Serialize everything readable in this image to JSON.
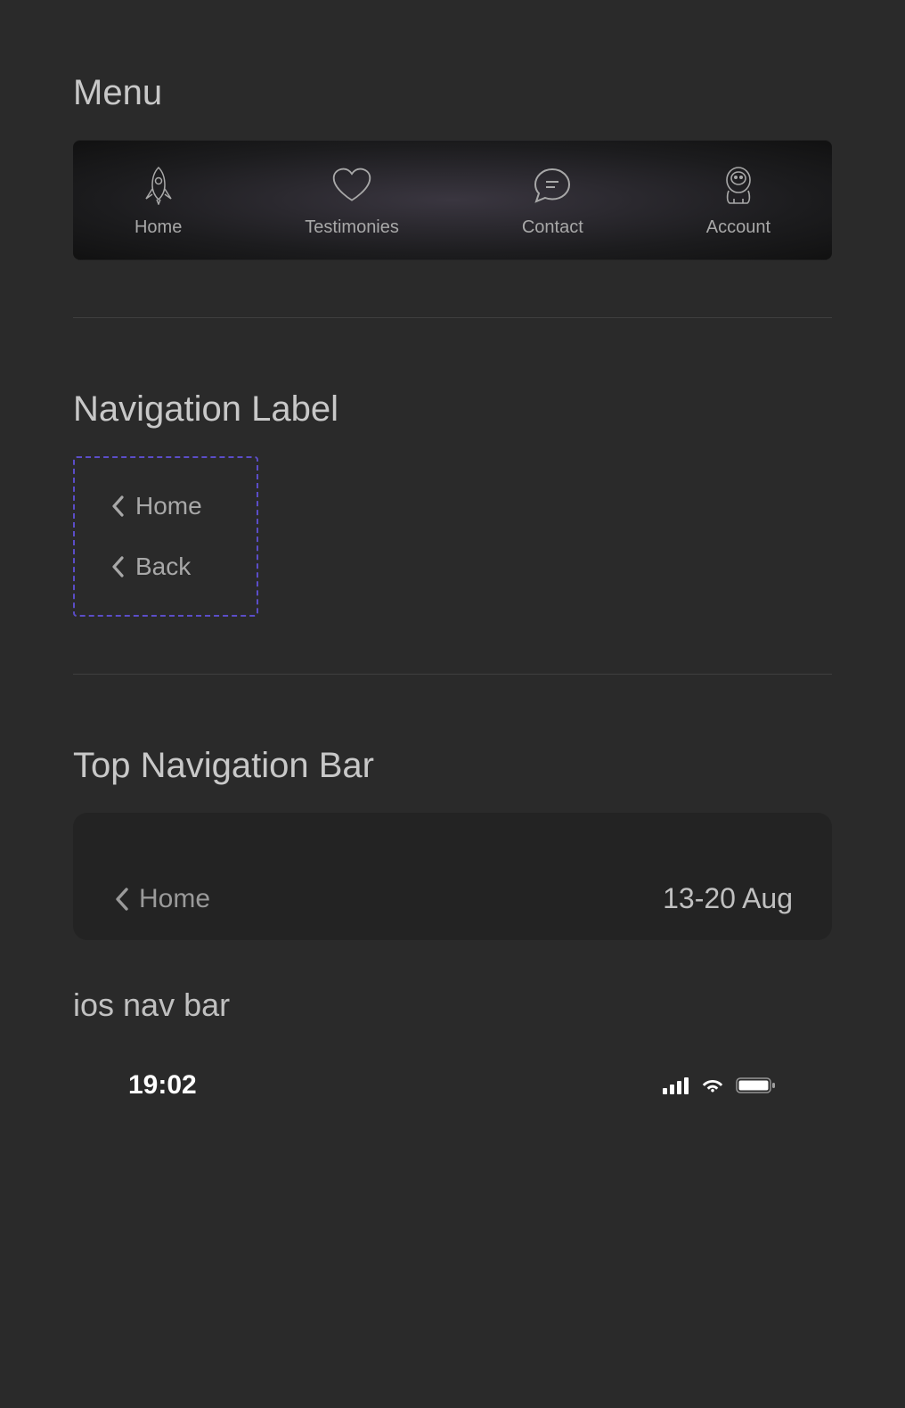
{
  "sections": {
    "menu_title": "Menu",
    "nav_label_title": "Navigation Label",
    "top_nav_title": "Top Navigation Bar",
    "ios_nav_title": "ios nav bar"
  },
  "menu": {
    "items": [
      {
        "icon": "rocket-icon",
        "label": "Home"
      },
      {
        "icon": "heart-icon",
        "label": "Testimonies"
      },
      {
        "icon": "chat-icon",
        "label": "Contact"
      },
      {
        "icon": "astronaut-icon",
        "label": "Account"
      }
    ]
  },
  "nav_labels": [
    {
      "label": "Home"
    },
    {
      "label": "Back"
    }
  ],
  "top_nav": {
    "back_label": "Home",
    "date_range": "13-20 Aug"
  },
  "ios_status": {
    "time": "19:02"
  }
}
